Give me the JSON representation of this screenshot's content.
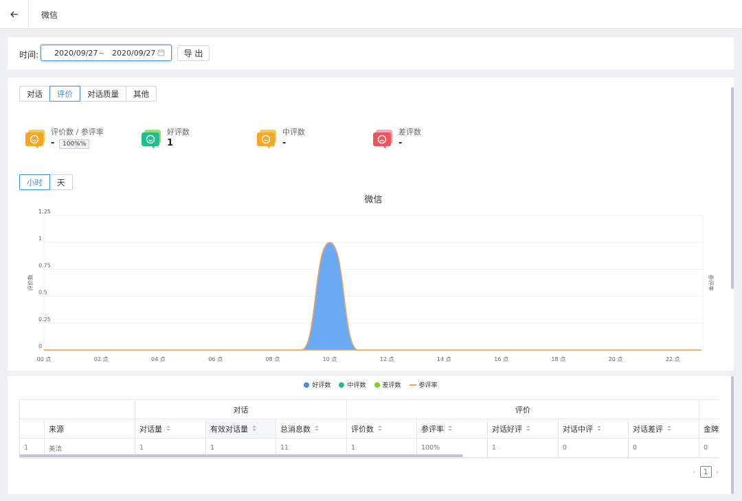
{
  "header": {
    "title": "微信"
  },
  "filter": {
    "time_label": "时间:",
    "date_start": "2020/09/27",
    "date_sep": "~",
    "date_end": "2020/09/27",
    "export_label": "导 出"
  },
  "tabs": [
    {
      "label": "对话"
    },
    {
      "label": "评价"
    },
    {
      "label": "对话质量"
    },
    {
      "label": "其他"
    }
  ],
  "active_tab": 1,
  "stats": [
    {
      "label": "评价数 / 参评率",
      "value": "-",
      "badge": "100%%",
      "color": "#f5a623"
    },
    {
      "label": "好评数",
      "value": "1",
      "color": "#1dbf8d"
    },
    {
      "label": "中评数",
      "value": "-",
      "color": "#f5a623"
    },
    {
      "label": "差评数",
      "value": "-",
      "color": "#f2545b"
    }
  ],
  "unit_tabs": [
    {
      "label": "小时"
    },
    {
      "label": "天"
    }
  ],
  "active_unit": 0,
  "colors": {
    "accent": "#3d8ee8",
    "area": "#6aaaf5",
    "rate_line": "#f0a460"
  },
  "chart_data": {
    "type": "area",
    "title": "微信",
    "ylabel": "评价数",
    "y2label": "参评率",
    "ylim": [
      0,
      1.25
    ],
    "yticks": [
      "0",
      "0.25",
      "0.5",
      "0.75",
      "1",
      "1.25"
    ],
    "xticks": [
      "00 点",
      "02 点",
      "04 点",
      "06 点",
      "08 点",
      "10 点",
      "12 点",
      "14 点",
      "16 点",
      "18 点",
      "20 点",
      "22 点"
    ],
    "x": [
      0,
      1,
      2,
      3,
      4,
      5,
      6,
      7,
      8,
      9,
      10,
      11,
      12,
      13,
      14,
      15,
      16,
      17,
      18,
      19,
      20,
      21,
      22,
      23
    ],
    "series": [
      {
        "name": "好评数",
        "values": [
          0,
          0,
          0,
          0,
          0,
          0,
          0,
          0,
          0,
          0,
          1,
          0,
          0,
          0,
          0,
          0,
          0,
          0,
          0,
          0,
          0,
          0,
          0,
          0
        ]
      },
      {
        "name": "中评数",
        "values": [
          0,
          0,
          0,
          0,
          0,
          0,
          0,
          0,
          0,
          0,
          0,
          0,
          0,
          0,
          0,
          0,
          0,
          0,
          0,
          0,
          0,
          0,
          0,
          0
        ]
      },
      {
        "name": "差评数",
        "values": [
          0,
          0,
          0,
          0,
          0,
          0,
          0,
          0,
          0,
          0,
          0,
          0,
          0,
          0,
          0,
          0,
          0,
          0,
          0,
          0,
          0,
          0,
          0,
          0
        ]
      },
      {
        "name": "参评率",
        "values": [
          0,
          0,
          0,
          0,
          0,
          0,
          0,
          0,
          0,
          0,
          0,
          0,
          0,
          0,
          0,
          0,
          0,
          0,
          0,
          0,
          0,
          0,
          0,
          0
        ]
      }
    ]
  },
  "legend": [
    {
      "name": "好评数",
      "color": "#3d8ee8",
      "shape": "dot"
    },
    {
      "name": "中评数",
      "color": "#1dbf8d",
      "shape": "dot"
    },
    {
      "name": "差评数",
      "color": "#7ed321",
      "shape": "dot"
    },
    {
      "name": "参评率",
      "color": "#f0a460",
      "shape": "line"
    }
  ],
  "table": {
    "group_dialog": "对话",
    "group_eval": "评价",
    "col_source": "来源",
    "cols": [
      "对话量",
      "有效对话量",
      "总消息数",
      "评价数",
      "参评率",
      "对话好评",
      "对话中评",
      "对话差评",
      "金牌对"
    ],
    "row": {
      "index": "1",
      "source": "美洽",
      "values": [
        "1",
        "1",
        "11",
        "1",
        "100%",
        "1",
        "0",
        "0",
        "0"
      ]
    }
  },
  "pager": {
    "current": "1"
  }
}
